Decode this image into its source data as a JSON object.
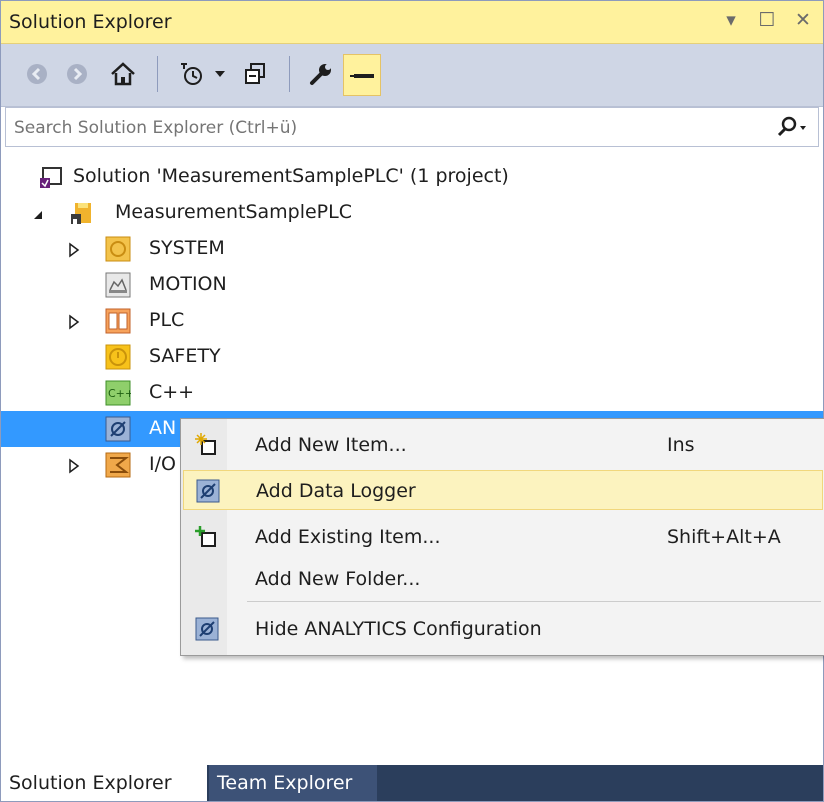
{
  "window": {
    "title": "Solution Explorer",
    "controls": {
      "dropdown": "▾",
      "maximize": "☐",
      "close": "✕"
    }
  },
  "toolbar": {
    "icons": [
      "back-icon",
      "forward-icon",
      "home-icon",
      "pending-changes-filter-icon",
      "dropdown-icon",
      "collapse-all-icon",
      "properties-icon",
      "pin-icon"
    ]
  },
  "search": {
    "placeholder": "Search Solution Explorer (Ctrl+ü)"
  },
  "tree": {
    "solution_label": "Solution 'MeasurementSamplePLC' (1 project)",
    "project_label": "MeasurementSamplePLC",
    "items": [
      {
        "label": "SYSTEM",
        "icon": "system-icon",
        "expandable": true
      },
      {
        "label": "MOTION",
        "icon": "motion-icon",
        "expandable": false
      },
      {
        "label": "PLC",
        "icon": "plc-icon",
        "expandable": true
      },
      {
        "label": "SAFETY",
        "icon": "safety-icon",
        "expandable": false
      },
      {
        "label": "C++",
        "icon": "cpp-icon",
        "expandable": false
      },
      {
        "label": "AN",
        "icon": "analytics-icon",
        "expandable": false,
        "selected": true
      },
      {
        "label": "I/O",
        "icon": "io-icon",
        "expandable": true
      }
    ]
  },
  "context_menu": {
    "items": [
      {
        "label": "Add New Item...",
        "shortcut": "Ins",
        "icon": "add-new-item-icon"
      },
      {
        "label": "Add Data Logger",
        "shortcut": "",
        "icon": "data-logger-icon",
        "highlighted": true
      },
      {
        "label": "Add Existing Item...",
        "shortcut": "Shift+Alt+A",
        "icon": "add-existing-item-icon"
      },
      {
        "label": "Add New Folder...",
        "shortcut": "",
        "icon": ""
      },
      {
        "label": "Hide ANALYTICS Configuration",
        "shortcut": "",
        "icon": "analytics-icon"
      }
    ]
  },
  "bottom_tabs": [
    {
      "label": "Solution Explorer",
      "active": true
    },
    {
      "label": "Team Explorer",
      "active": false
    }
  ],
  "colors": {
    "title_bar": "#fff29d",
    "selection": "#3399ff",
    "menu_highlight": "#fcf3bf",
    "bottom_bar": "#2b3e5c"
  }
}
